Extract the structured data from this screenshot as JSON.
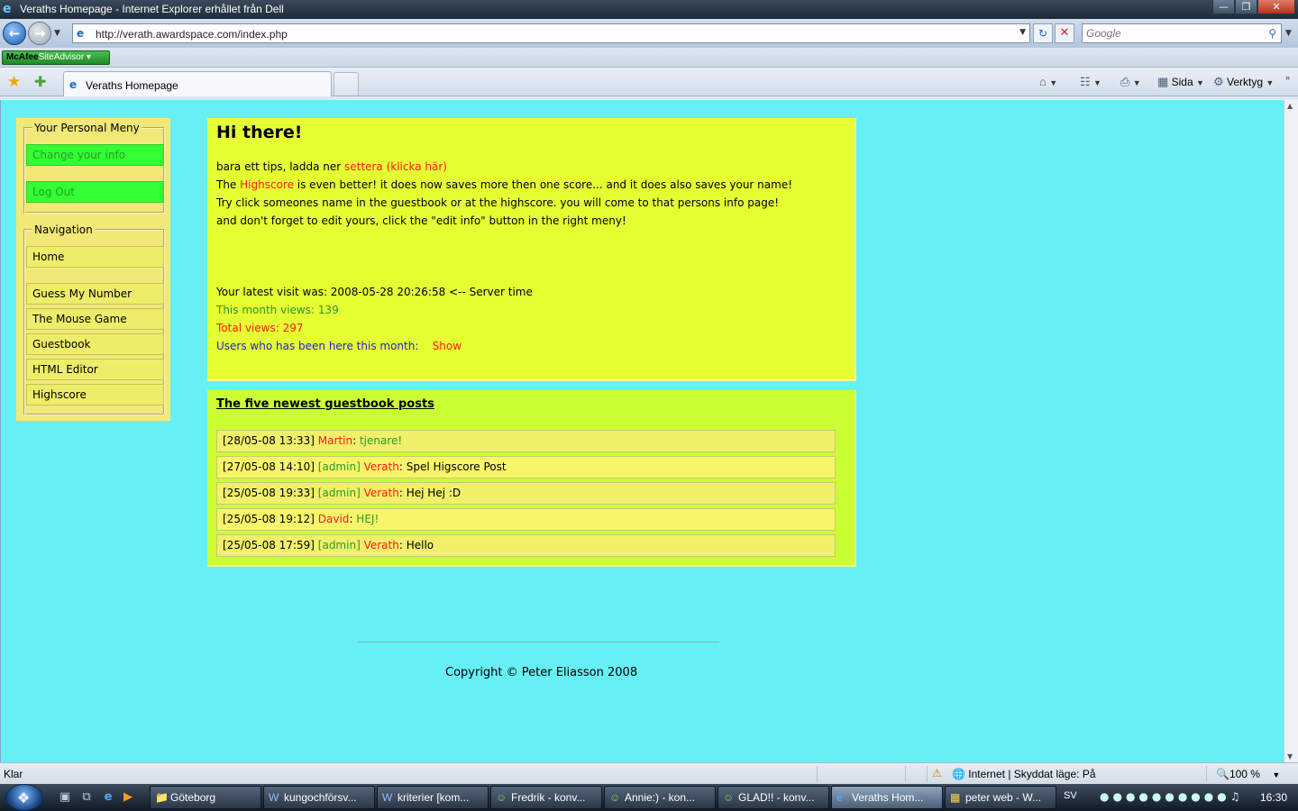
{
  "window": {
    "title": "Veraths Homepage - Internet Explorer erhållet från Dell"
  },
  "browser": {
    "url": "http://verath.awardspace.com/index.php",
    "search_placeholder": "Google",
    "addon_brand": "McAfee",
    "addon_suffix": "SiteAdvisor",
    "tab_label": "Veraths Homepage",
    "cmd_sida": "Sida",
    "cmd_verktyg": "Verktyg"
  },
  "sidebar": {
    "personal_legend": "Your Personal Meny",
    "personal_items": [
      "Change your info",
      "Log Out"
    ],
    "nav_legend": "Navigation",
    "nav_items": [
      "Home",
      "Guess My Number",
      "The Mouse Game",
      "Guestbook",
      "HTML Editor",
      "Highscore"
    ]
  },
  "welcome": {
    "heading": "Hi there!",
    "tip_prefix": "bara ett tips, ladda ner ",
    "tip_link": "settera (klicka här)",
    "hs_prefix": "The ",
    "hs_link": "Highscore",
    "hs_suffix": " is even better! it does now saves more then one score... and it does also saves your name!",
    "line3": "Try click someones name in the guestbook or at the highscore. you will come to that persons info page!",
    "line4": "and don't forget to edit yours, click the \"edit info\" button in the right meny!",
    "last_visit": "Your latest visit was: 2008-05-28 20:26:58 <-- Server time",
    "month_views": "This month views: 139",
    "total_views": "Total views: 297",
    "users_label": "Users who has been here this month:",
    "users_show": "Show"
  },
  "guestbook": {
    "heading": "The five newest guestbook posts",
    "posts": [
      {
        "time": "[28/05-08 13:33]",
        "admin": "",
        "name": "Martin",
        "message": "tjenare!"
      },
      {
        "time": "[27/05-08 14:10]",
        "admin": "[admin]",
        "name": "Verath",
        "message": "Spel Higscore Post"
      },
      {
        "time": "[25/05-08 19:33]",
        "admin": "[admin]",
        "name": "Verath",
        "message": "Hej Hej :D"
      },
      {
        "time": "[25/05-08 19:12]",
        "admin": "",
        "name": "David",
        "message": "HEJ!"
      },
      {
        "time": "[25/05-08 17:59]",
        "admin": "[admin]",
        "name": "Verath",
        "message": "Hello"
      }
    ]
  },
  "footer": {
    "copyright": "Copyright © Peter Eliasson 2008"
  },
  "status": {
    "text": "Klar",
    "zone": "Internet | Skyddat läge: På",
    "zoom": "100 %"
  },
  "taskbar": {
    "items": [
      "Göteborg",
      "kungochförsv...",
      "kriterier [kom...",
      "Fredrik - konv...",
      "Annie:) - kon...",
      "GLAD!! - konv...",
      "Veraths Hom...",
      "peter web - W..."
    ],
    "lang": "SV",
    "clock": "16:30"
  },
  "colors": {
    "page_bg": "#66f0f5",
    "box1_bg": "#e5ff33",
    "box2_bg": "#ccff33",
    "menu_bg": "#f1e878",
    "button_green": "#33ff33",
    "link_red": "#ff1a1a"
  }
}
